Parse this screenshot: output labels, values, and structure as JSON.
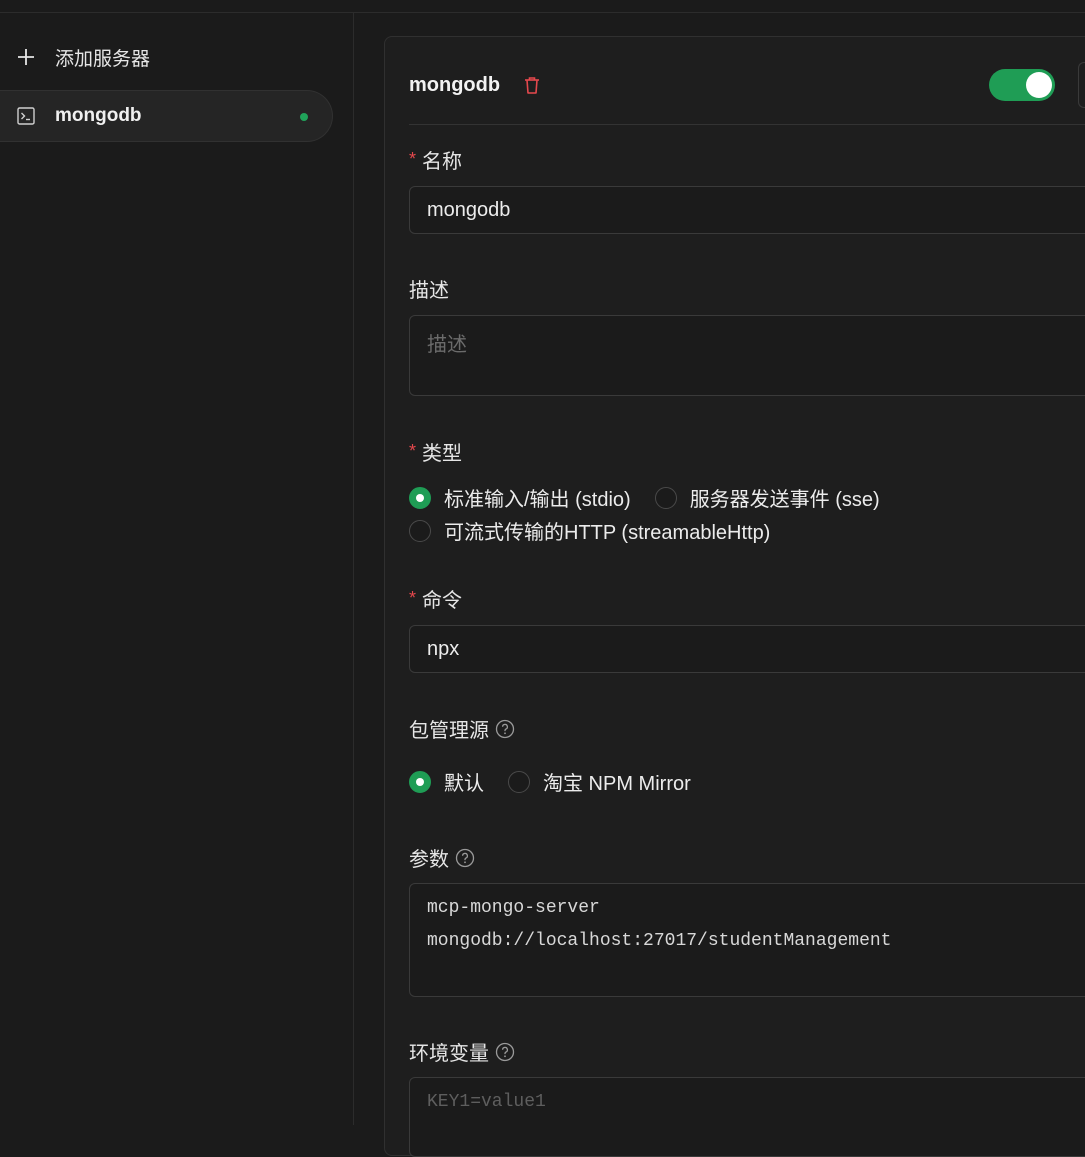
{
  "sidebar": {
    "add_label": "添加服务器",
    "servers": [
      {
        "name": "mongodb",
        "status": "active"
      }
    ]
  },
  "server": {
    "title": "mongodb",
    "enabled": true
  },
  "form": {
    "name": {
      "label": "名称",
      "required": true,
      "value": "mongodb"
    },
    "description": {
      "label": "描述",
      "placeholder": "描述",
      "value": ""
    },
    "type": {
      "label": "类型",
      "required": true,
      "options": [
        "标准输入/输出 (stdio)",
        "服务器发送事件 (sse)",
        "可流式传输的HTTP (streamableHttp)"
      ],
      "selected": "标准输入/输出 (stdio)"
    },
    "command": {
      "label": "命令",
      "required": true,
      "value": "npx"
    },
    "registry": {
      "label": "包管理源",
      "options": [
        "默认",
        "淘宝 NPM Mirror"
      ],
      "selected": "默认"
    },
    "args": {
      "label": "参数",
      "lines": [
        "mcp-mongo-server",
        "mongodb://localhost:27017/studentManagement"
      ]
    },
    "env": {
      "label": "环境变量",
      "placeholder": "KEY1=value1"
    }
  },
  "colors": {
    "accent": "#1f9d55",
    "required": "#e5484d",
    "danger": "#e5484d",
    "background": "#1b1b1b"
  }
}
